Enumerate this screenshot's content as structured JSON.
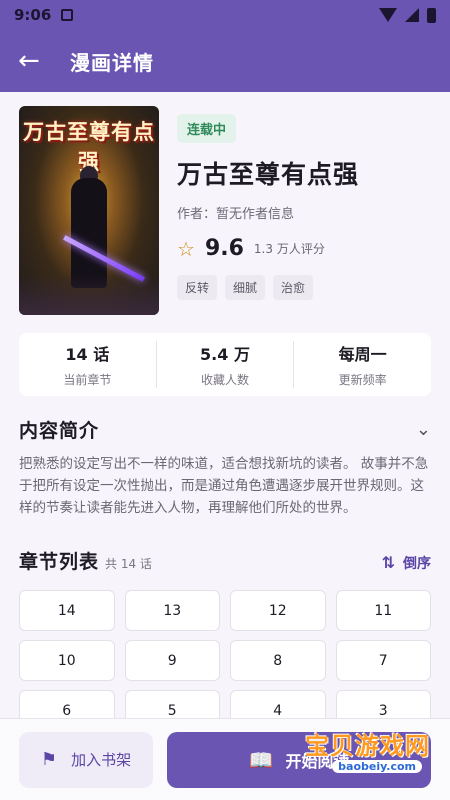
{
  "status_bar": {
    "time": "9:06"
  },
  "app_bar": {
    "title": "漫画详情"
  },
  "comic": {
    "cover_title": "万古至尊有点强",
    "status_badge": "连载中",
    "title": "万古至尊有点强",
    "author": "作者：暂无作者信息",
    "score": "9.6",
    "rating_count": "1.3 万人评分",
    "tags": [
      "反转",
      "细腻",
      "治愈"
    ]
  },
  "stats": [
    {
      "value": "14 话",
      "label": "当前章节"
    },
    {
      "value": "5.4 万",
      "label": "收藏人数"
    },
    {
      "value": "每周一",
      "label": "更新频率"
    }
  ],
  "summary": {
    "title": "内容简介",
    "text": "把熟悉的设定写出不一样的味道，适合想找新坑的读者。 故事并不急于把所有设定一次性抛出，而是通过角色遭遇逐步展开世界规则。这样的节奏让读者能先进入人物，再理解他们所处的世界。"
  },
  "chapters": {
    "title": "章节列表",
    "count": "共 14 话",
    "sort_label": "倒序",
    "items": [
      "14",
      "13",
      "12",
      "11",
      "10",
      "9",
      "8",
      "7",
      "6",
      "5",
      "4",
      "3"
    ]
  },
  "bottom": {
    "shelf_label": "加入书架",
    "read_label": "开始阅读"
  },
  "watermark": {
    "text": "宝贝游戏网",
    "url": "baobeiy.com"
  },
  "colors": {
    "primary": "#6a56b2",
    "badge_green": "#2f8a5a",
    "star": "#d08a1a"
  }
}
